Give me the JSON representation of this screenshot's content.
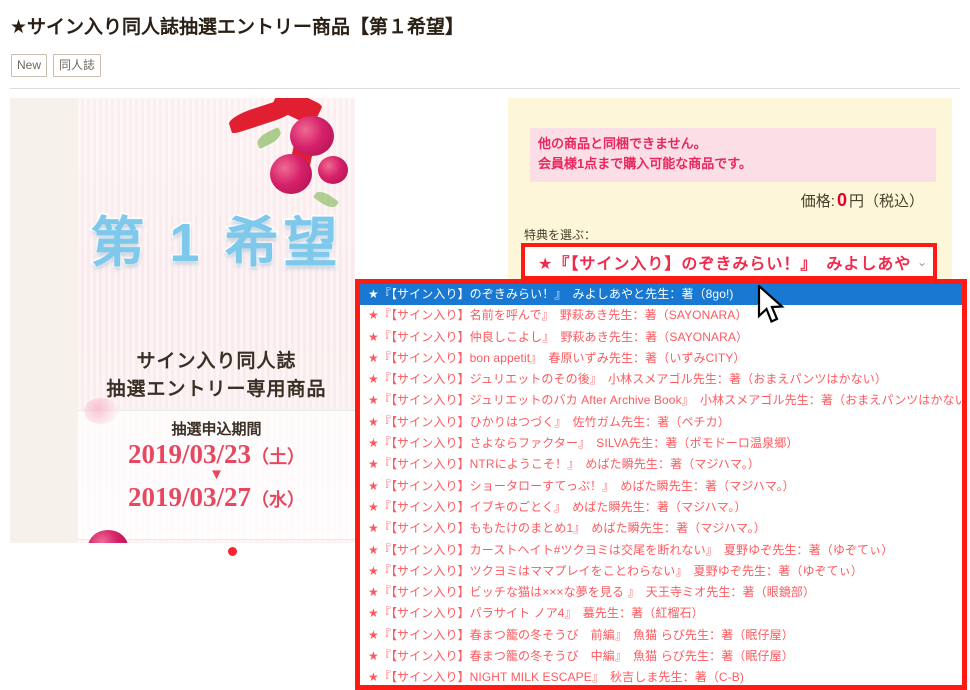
{
  "header": {
    "title": "★サイン入り同人誌抽選エントリー商品【第１希望】",
    "badges": [
      "New",
      "同人誌"
    ]
  },
  "product_image": {
    "main_text": "第 1 希望",
    "sub_line_1": "サイン入り同人誌",
    "sub_line_2": "抽選エントリー専用商品",
    "period_label": "抽選申込期間",
    "period_start": "2019/03/23",
    "period_start_weekday": "（土）",
    "period_arrow": "▼",
    "period_end": "2019/03/27",
    "period_end_weekday": "（水）"
  },
  "buy_panel": {
    "notice_line_1": "他の商品と同梱できません。",
    "notice_line_2": "会員様1点まで購入可能な商品です。",
    "price_label": "価格:",
    "price_amount": "0",
    "price_unit": "円（税込）",
    "select_label": "特典を選ぶ：",
    "selected_value": "★『【サイン入り】のぞきみらい！』　みよしあや",
    "caret": "⌄"
  },
  "dropdown": {
    "options": [
      "★『【サイン入り】のぞきみらい！』　みよしあやと先生：著（8go!)",
      "★『【サイン入り】名前を呼んで』　野萩あき先生：著（SAYONARA）",
      "★『【サイン入り】仲良しこよし』　野萩あき先生：著（SAYONARA）",
      "★『【サイン入り】bon appetit』　春原いずみ先生：著（いずみCITY）",
      "★『【サイン入り】ジュリエットのその後』　小林スメアゴル先生：著（おまえパンツはかない）",
      "★『【サイン入り】ジュリエットのバカ After Archive Book』　小林スメアゴル先生：著（おまえパンツはかない）",
      "★『【サイン入り】ひかりはつづく』　佐竹ガム先生：著（ペチカ）",
      "★『【サイン入り】さよならファクター』　SILVA先生：著（ポモドーロ温泉郷）",
      "★『【サイン入り】NTRにようこそ！』　めばた瞬先生：著（マジハマ。）",
      "★『【サイン入り】ショータローすてっぷ！』　めばた瞬先生：著（マジハマ。）",
      "★『【サイン入り】イブキのごとく』　めばた瞬先生：著（マジハマ。）",
      "★『【サイン入り】ももたけのまとめ1』　めばた瞬先生：著（マジハマ。）",
      "★『【サイン入り】カーストヘイト#ツクヨミは交尾を断れない』　夏野ゆぞ先生：著（ゆぞてぃ）",
      "★『【サイン入り】ツクヨミはママプレイをことわらない』　夏野ゆぞ先生：著（ゆぞてぃ）",
      "★『【サイン入り】ビッチな猫は×××な夢を見る 』　天王寺ミオ先生：著（眼鏡部）",
      "★『【サイン入り】パラサイト ノア4』　蟇先生：著（紅榴石）",
      "★『【サイン入り】春まつ籠の冬そうび　前編』　魚猫 らび先生：著（眠仔屋）",
      "★『【サイン入り】春まつ籠の冬そうび　中編』　魚猫 らび先生：著（眠仔屋）",
      "★『【サイン入り】NIGHT MILK ESCAPE』　秋吉しま先生：著（C-B)"
    ],
    "selected_index": 0
  },
  "colors": {
    "accent_red": "#ff1a14",
    "option_text": "#fd5a5f",
    "highlight_blue": "#1878d2",
    "panel_yellow": "#fdf6d8",
    "notice_pink": "#fcdfe6"
  }
}
